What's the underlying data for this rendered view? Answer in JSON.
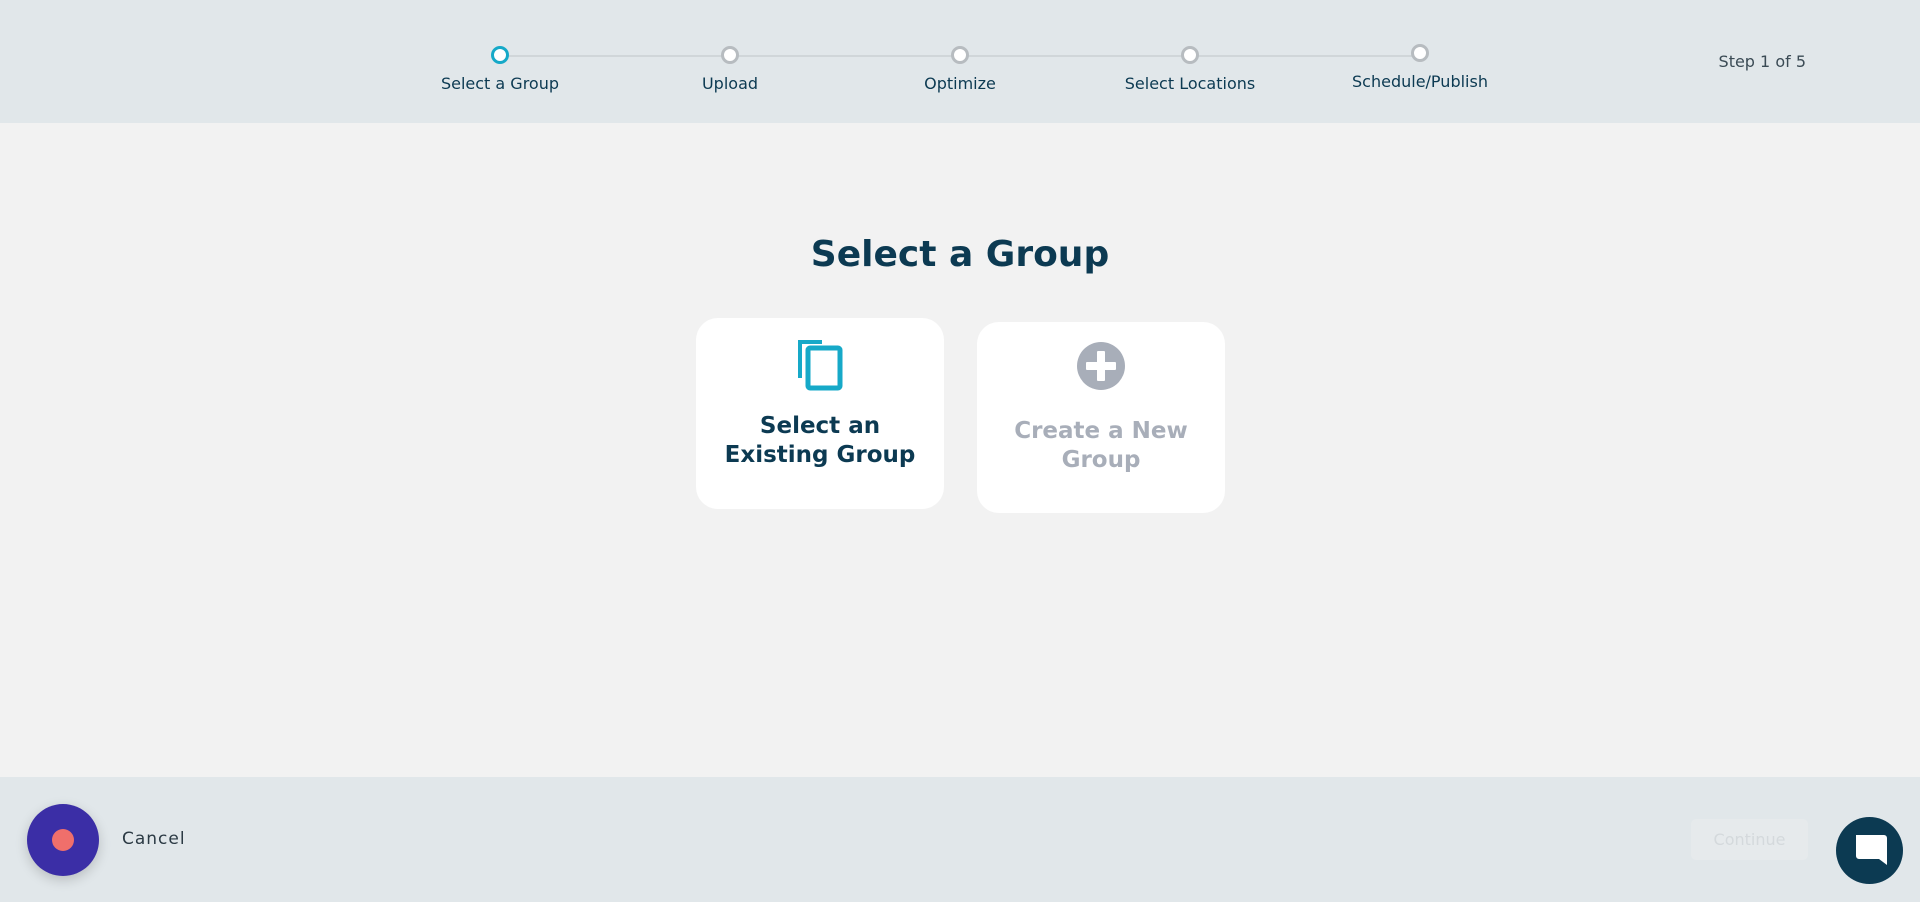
{
  "stepper": {
    "steps": [
      {
        "label": "Select a Group",
        "active": true
      },
      {
        "label": "Upload",
        "active": false
      },
      {
        "label": "Optimize",
        "active": false
      },
      {
        "label": "Select Locations",
        "active": false
      },
      {
        "label": "Schedule/Publish",
        "active": false
      }
    ],
    "step_count": "Step 1 of 5"
  },
  "main": {
    "title": "Select a Group",
    "cards": {
      "existing": {
        "label": "Select an Existing Group",
        "icon": "copy-icon"
      },
      "new": {
        "label": "Create a New Group",
        "icon": "plus-circle-icon"
      }
    }
  },
  "footer": {
    "cancel_label": "Cancel",
    "continue_label": "Continue",
    "record_icon": "record-icon",
    "chat_icon": "chat-icon"
  },
  "colors": {
    "accent": "#16a9c8",
    "primary_text": "#0c3a52",
    "disabled_text": "#a8aeb9",
    "record_button": "#3b2ea6",
    "record_dot": "#f06f6b"
  }
}
